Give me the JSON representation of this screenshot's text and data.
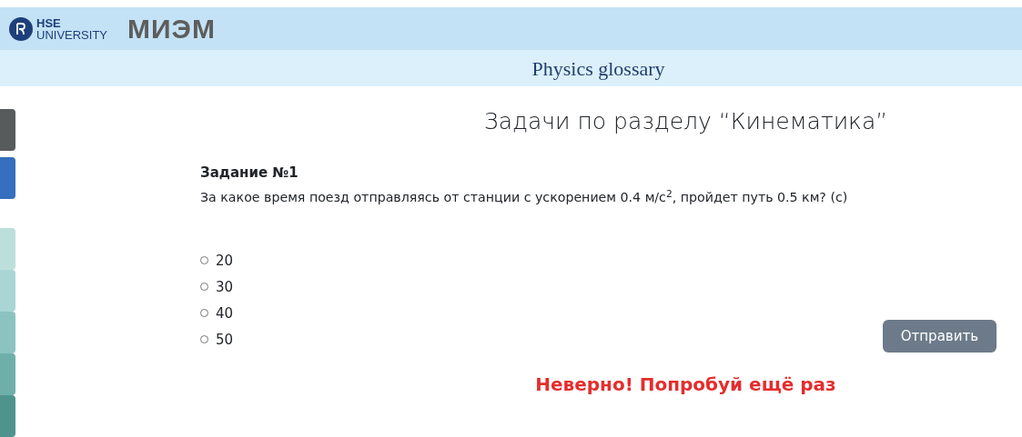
{
  "header": {
    "logo_text_top": "HSE",
    "logo_text_bottom": "UNIVERSITY",
    "brand": "МИЭМ"
  },
  "subheader": {
    "title": "Physics glossary"
  },
  "side_tabs": [
    {
      "color": "#585b5b"
    },
    {
      "color": "#356fbd"
    },
    {
      "color": "#bddfdc"
    },
    {
      "color": "#a9d6d5"
    },
    {
      "color": "#8bc3c1"
    },
    {
      "color": "#6fafaa"
    },
    {
      "color": "#4e948d"
    }
  ],
  "page_title": "Задачи по разделу “Кинематика”",
  "task": {
    "title": "Задание №1",
    "question": "За какое время поезд отправляясь от станции с ускорением 0.4 м/с$^{2}$, пройдет путь 0.5 км? (с)",
    "options": [
      {
        "label": "20",
        "selected": false
      },
      {
        "label": "30",
        "selected": false
      },
      {
        "label": "40",
        "selected": false
      },
      {
        "label": "50",
        "selected": false
      }
    ],
    "submit": "Отправить"
  },
  "feedback": {
    "text": "Неверно! Попробуй ещё раз",
    "kind": "error"
  }
}
